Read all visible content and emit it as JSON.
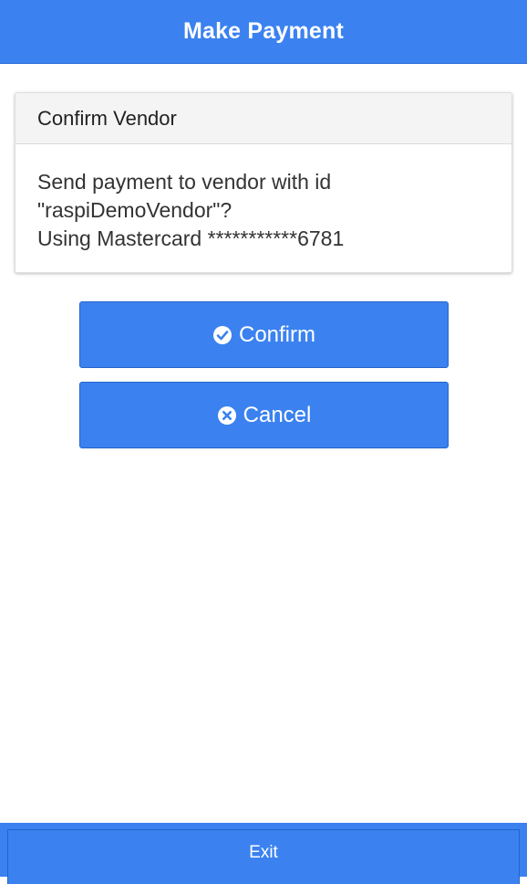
{
  "header": {
    "title": "Make Payment"
  },
  "card": {
    "title": "Confirm Vendor",
    "body_lines": [
      "Send payment to vendor with id",
      "\"raspiDemoVendor\"?",
      "Using Mastercard ***********6781"
    ]
  },
  "buttons": {
    "confirm": {
      "label": "Confirm",
      "icon": "check-circle-icon"
    },
    "cancel": {
      "label": "Cancel",
      "icon": "close-circle-icon"
    }
  },
  "footer": {
    "exit_label": "Exit"
  },
  "colors": {
    "primary": "#3b82f0",
    "primary_border": "#2563c9",
    "card_header_bg": "#f4f4f4",
    "text": "#333333"
  }
}
